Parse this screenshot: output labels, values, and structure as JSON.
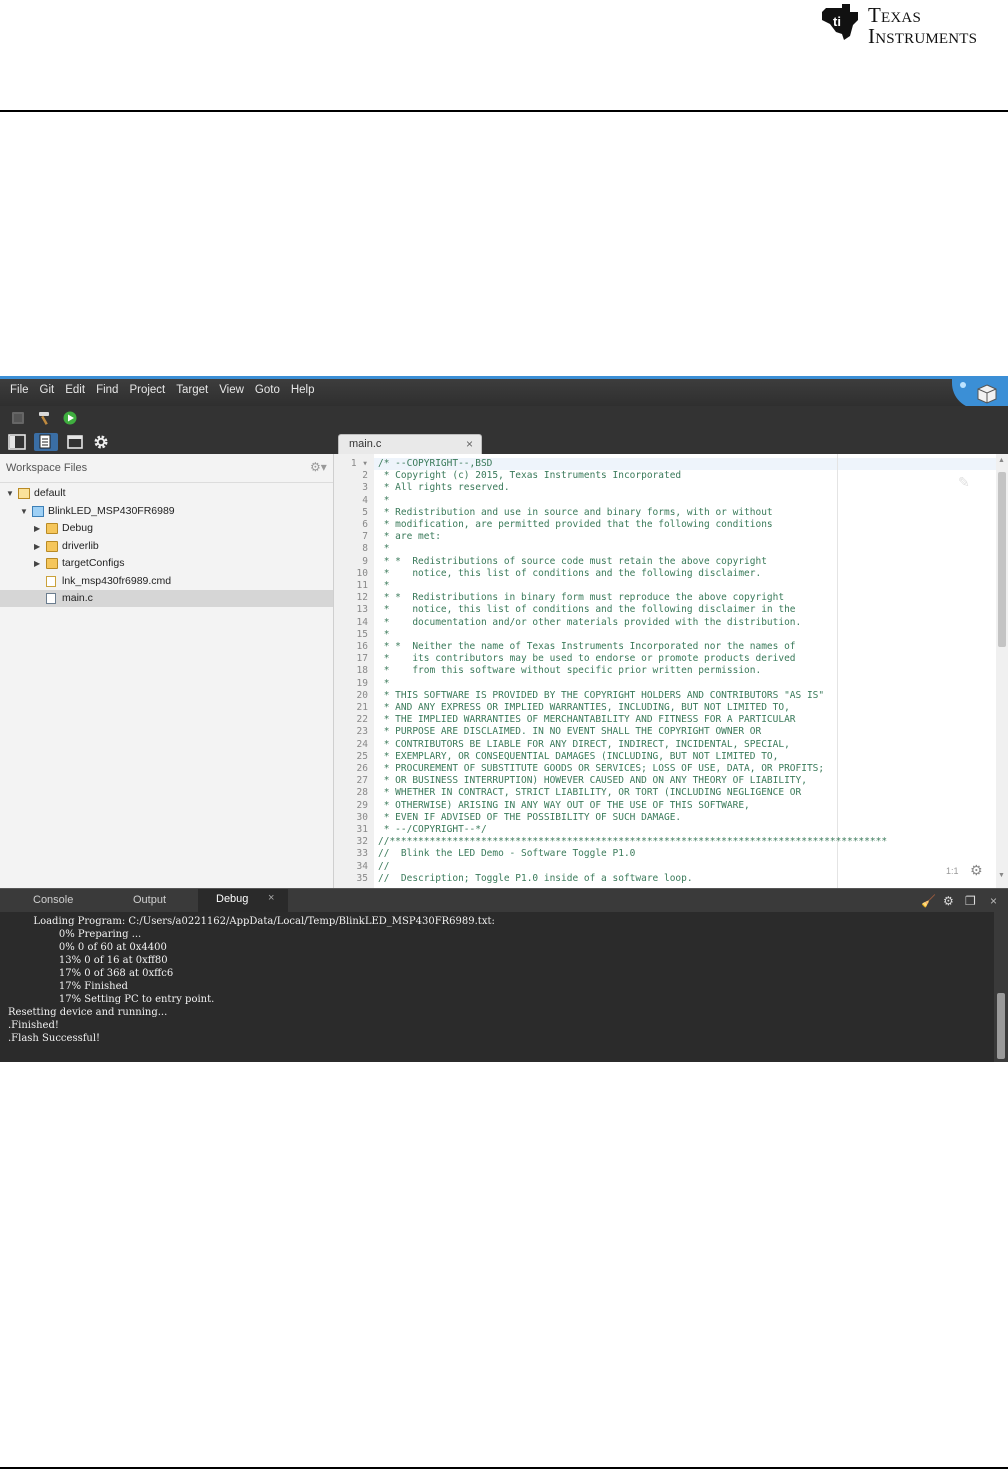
{
  "document": {
    "logo_line1": "Texas",
    "logo_line2": "Instruments"
  },
  "ide": {
    "menu": [
      "File",
      "Git",
      "Edit",
      "Find",
      "Project",
      "Target",
      "View",
      "Goto",
      "Help"
    ],
    "toolbar_icons": [
      "debug-disabled-icon",
      "build-hammer-icon",
      "run-icon"
    ],
    "view_icons": [
      "toggle-sidebar-icon",
      "file-explorer-icon",
      "browser-window-icon",
      "settings-gear-icon"
    ],
    "file_panel": {
      "title": "Workspace Files",
      "tree": [
        {
          "label": "default",
          "icon": "workspace",
          "arrow": "▼",
          "indent": 0
        },
        {
          "label": "BlinkLED_MSP430FR6989",
          "icon": "project",
          "arrow": "▼",
          "indent": 1
        },
        {
          "label": "Debug",
          "icon": "folder",
          "arrow": "▶",
          "indent": 2
        },
        {
          "label": "driverlib",
          "icon": "folder",
          "arrow": "▶",
          "indent": 2
        },
        {
          "label": "targetConfigs",
          "icon": "folder",
          "arrow": "▶",
          "indent": 2
        },
        {
          "label": "lnk_msp430fr6989.cmd",
          "icon": "cmd-file",
          "arrow": "",
          "indent": 2
        },
        {
          "label": "main.c",
          "icon": "c-file",
          "arrow": "",
          "indent": 2,
          "selected": true
        }
      ]
    },
    "editor": {
      "tab_label": "main.c",
      "tab_close": "×",
      "cursor_position": "1:1",
      "lines": [
        "/* --COPYRIGHT--,BSD",
        " * Copyright (c) 2015, Texas Instruments Incorporated",
        " * All rights reserved.",
        " *",
        " * Redistribution and use in source and binary forms, with or without",
        " * modification, are permitted provided that the following conditions",
        " * are met:",
        " *",
        " * *  Redistributions of source code must retain the above copyright",
        " *    notice, this list of conditions and the following disclaimer.",
        " *",
        " * *  Redistributions in binary form must reproduce the above copyright",
        " *    notice, this list of conditions and the following disclaimer in the",
        " *    documentation and/or other materials provided with the distribution.",
        " *",
        " * *  Neither the name of Texas Instruments Incorporated nor the names of",
        " *    its contributors may be used to endorse or promote products derived",
        " *    from this software without specific prior written permission.",
        " *",
        " * THIS SOFTWARE IS PROVIDED BY THE COPYRIGHT HOLDERS AND CONTRIBUTORS \"AS IS\"",
        " * AND ANY EXPRESS OR IMPLIED WARRANTIES, INCLUDING, BUT NOT LIMITED TO,",
        " * THE IMPLIED WARRANTIES OF MERCHANTABILITY AND FITNESS FOR A PARTICULAR",
        " * PURPOSE ARE DISCLAIMED. IN NO EVENT SHALL THE COPYRIGHT OWNER OR",
        " * CONTRIBUTORS BE LIABLE FOR ANY DIRECT, INDIRECT, INCIDENTAL, SPECIAL,",
        " * EXEMPLARY, OR CONSEQUENTIAL DAMAGES (INCLUDING, BUT NOT LIMITED TO,",
        " * PROCUREMENT OF SUBSTITUTE GOODS OR SERVICES; LOSS OF USE, DATA, OR PROFITS;",
        " * OR BUSINESS INTERRUPTION) HOWEVER CAUSED AND ON ANY THEORY OF LIABILITY,",
        " * WHETHER IN CONTRACT, STRICT LIABILITY, OR TORT (INCLUDING NEGLIGENCE OR",
        " * OTHERWISE) ARISING IN ANY WAY OUT OF THE USE OF THIS SOFTWARE,",
        " * EVEN IF ADVISED OF THE POSSIBILITY OF SUCH DAMAGE.",
        " * --/COPYRIGHT--*/",
        "//***************************************************************************************",
        "//  Blink the LED Demo - Software Toggle P1.0",
        "//",
        "//  Description; Toggle P1.0 inside of a software loop."
      ]
    },
    "console": {
      "tabs": [
        "Console",
        "Output",
        "Debug"
      ],
      "active_tab": "Debug",
      "close": "×",
      "lines": [
        "        Loading Program: C:/Users/a0221162/AppData/Local/Temp/BlinkLED_MSP430FR6989.txt:",
        "                0% Preparing ...",
        "                0% 0 of 60 at 0x4400",
        "                13% 0 of 16 at 0xff80",
        "                17% 0 of 368 at 0xffc6",
        "                17% Finished",
        "                17% Setting PC to entry point.",
        "Resetting device and running...",
        ".Finished!",
        ".Flash Successful!"
      ]
    },
    "colors": {
      "accent": "#3b8fd6",
      "chrome": "#2b2b2b",
      "code_comment": "#3a7a5a",
      "ti_red": "#cc0000"
    }
  }
}
